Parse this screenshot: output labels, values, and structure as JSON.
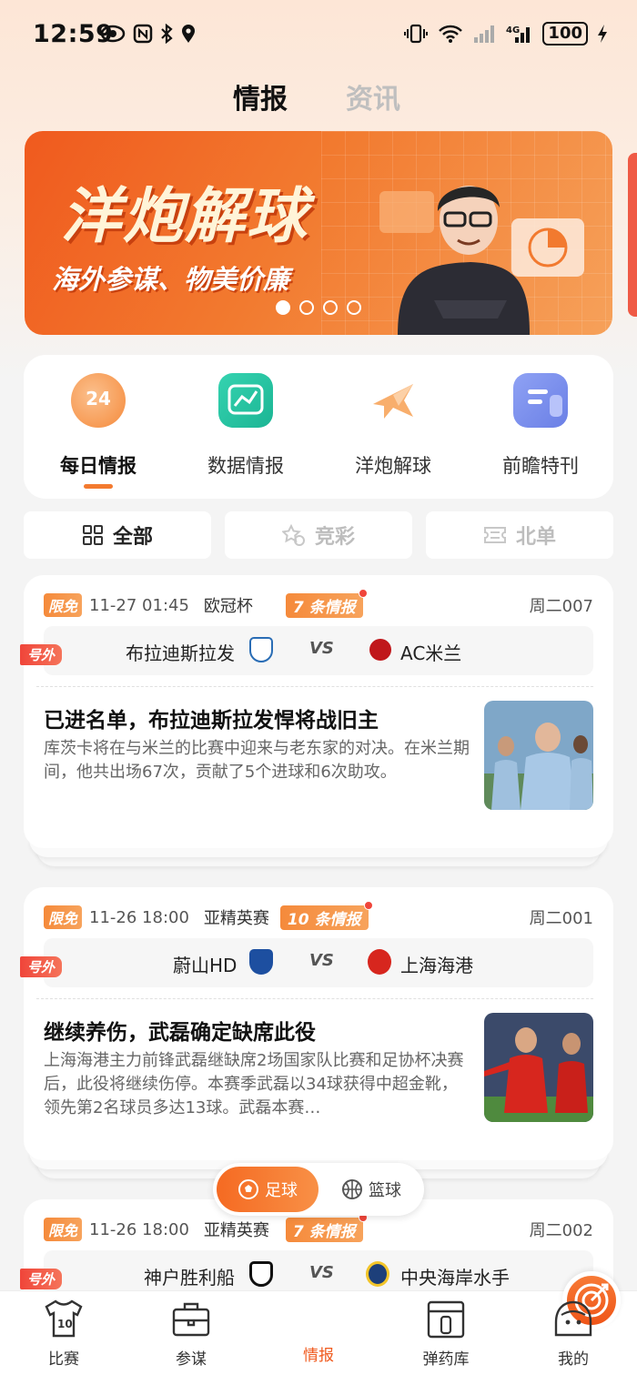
{
  "status_bar": {
    "time": "12:59",
    "battery": "100"
  },
  "top_tabs": [
    {
      "label": "情报",
      "active": true
    },
    {
      "label": "资讯",
      "active": false
    }
  ],
  "banner": {
    "title": "洋炮解球",
    "subtitle": "海外参谋、物美价廉",
    "page_count": 4,
    "current_page": 1
  },
  "categories": [
    {
      "label": "每日情报",
      "icon": "calendar-24-icon",
      "icon_text": "24",
      "active": true
    },
    {
      "label": "数据情报",
      "icon": "chart-line-icon",
      "active": false
    },
    {
      "label": "洋炮解球",
      "icon": "airplane-icon",
      "active": false
    },
    {
      "label": "前瞻特刊",
      "icon": "document-icon",
      "active": false
    }
  ],
  "filters": [
    {
      "label": "全部",
      "icon": "grid-icon",
      "active": true
    },
    {
      "label": "竞彩",
      "icon": "star-ticket-icon",
      "active": false
    },
    {
      "label": "北单",
      "icon": "ticket-icon",
      "active": false
    }
  ],
  "matches": [
    {
      "free_tag": "限免",
      "datetime": "11-27 01:45",
      "league": "欧冠杯",
      "intel_count": "7 条情报",
      "week_no": "周二007",
      "special_tag": "号外",
      "home": "布拉迪斯拉发",
      "vs": "VS",
      "away": "AC米兰",
      "headline": "已进名单，布拉迪斯拉发悍将战旧主",
      "summary": "库茨卡将在与米兰的比赛中迎来与老东家的对决。在米兰期间，他共出场67次，贡献了5个进球和6次助攻。",
      "home_color": "#2a6db5",
      "away_color": "#c0171b"
    },
    {
      "free_tag": "限免",
      "datetime": "11-26 18:00",
      "league": "亚精英赛",
      "intel_count": "10 条情报",
      "week_no": "周二001",
      "special_tag": "号外",
      "home": "蔚山HD",
      "vs": "VS",
      "away": "上海海港",
      "headline": "继续养伤，武磊确定缺席此役",
      "summary": "上海海港主力前锋武磊继缺席2场国家队比赛和足协杯决赛后，此役将继续伤停。本赛季武磊以34球获得中超金靴，领先第2名球员多达13球。武磊本赛…",
      "home_color": "#1d4fa0",
      "away_color": "#d7261e"
    },
    {
      "free_tag": "限免",
      "datetime": "11-26 18:00",
      "league": "亚精英赛",
      "intel_count": "7 条情报",
      "week_no": "周二002",
      "special_tag": "号外",
      "home": "神户胜利船",
      "vs": "VS",
      "away": "中央海岸水手",
      "home_color": "#111111",
      "away_color": "#1d3f7a"
    }
  ],
  "sport_toggle": [
    {
      "label": "足球",
      "active": true
    },
    {
      "label": "篮球",
      "active": false
    }
  ],
  "bottom_nav": [
    {
      "label": "比赛",
      "icon": "jersey-icon",
      "icon_text": "10",
      "active": false
    },
    {
      "label": "参谋",
      "icon": "briefcase-icon",
      "active": false
    },
    {
      "label": "情报",
      "icon": "target-icon",
      "active": true
    },
    {
      "label": "弹药库",
      "icon": "ammo-box-icon",
      "active": false
    },
    {
      "label": "我的",
      "icon": "profile-icon",
      "active": false
    }
  ],
  "colors": {
    "accent": "#f05a1e",
    "accent_light": "#f7a35c",
    "red_tag": "#f0453a"
  }
}
